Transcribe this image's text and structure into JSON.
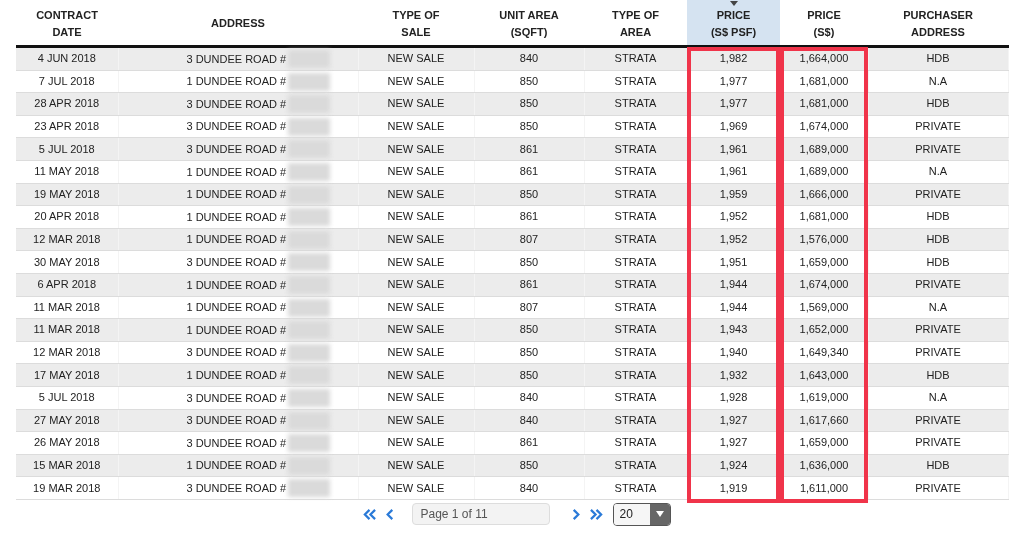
{
  "table": {
    "address_redacted": true,
    "columns": [
      {
        "label": "CONTRACT\nDATE",
        "sorted": false,
        "highlighted": false
      },
      {
        "label": "ADDRESS",
        "sorted": false,
        "highlighted": false
      },
      {
        "label": "TYPE OF\nSALE",
        "sorted": false,
        "highlighted": false
      },
      {
        "label": "UNIT AREA\n(SQFT)",
        "sorted": false,
        "highlighted": false
      },
      {
        "label": "TYPE OF\nAREA",
        "sorted": false,
        "highlighted": false
      },
      {
        "label": "PRICE\n(S$ PSF)",
        "sorted": true,
        "highlighted": true
      },
      {
        "label": "PRICE\n(S$)",
        "sorted": false,
        "highlighted": true
      },
      {
        "label": "PURCHASER\nADDRESS",
        "sorted": false,
        "highlighted": false
      }
    ],
    "rows": [
      [
        "4 JUN 2018",
        "3 DUNDEE ROAD #",
        "NEW SALE",
        "840",
        "STRATA",
        "1,982",
        "1,664,000",
        "HDB"
      ],
      [
        "7 JUL 2018",
        "1 DUNDEE ROAD #",
        "NEW SALE",
        "850",
        "STRATA",
        "1,977",
        "1,681,000",
        "N.A"
      ],
      [
        "28 APR 2018",
        "3 DUNDEE ROAD #",
        "NEW SALE",
        "850",
        "STRATA",
        "1,977",
        "1,681,000",
        "HDB"
      ],
      [
        "23 APR 2018",
        "3 DUNDEE ROAD #",
        "NEW SALE",
        "850",
        "STRATA",
        "1,969",
        "1,674,000",
        "PRIVATE"
      ],
      [
        "5 JUL 2018",
        "3 DUNDEE ROAD #",
        "NEW SALE",
        "861",
        "STRATA",
        "1,961",
        "1,689,000",
        "PRIVATE"
      ],
      [
        "11 MAY 2018",
        "1 DUNDEE ROAD #",
        "NEW SALE",
        "861",
        "STRATA",
        "1,961",
        "1,689,000",
        "N.A"
      ],
      [
        "19 MAY 2018",
        "1 DUNDEE ROAD #",
        "NEW SALE",
        "850",
        "STRATA",
        "1,959",
        "1,666,000",
        "PRIVATE"
      ],
      [
        "20 APR 2018",
        "1 DUNDEE ROAD #",
        "NEW SALE",
        "861",
        "STRATA",
        "1,952",
        "1,681,000",
        "HDB"
      ],
      [
        "12 MAR 2018",
        "1 DUNDEE ROAD #",
        "NEW SALE",
        "807",
        "STRATA",
        "1,952",
        "1,576,000",
        "HDB"
      ],
      [
        "30 MAY 2018",
        "3 DUNDEE ROAD #",
        "NEW SALE",
        "850",
        "STRATA",
        "1,951",
        "1,659,000",
        "HDB"
      ],
      [
        "6 APR 2018",
        "1 DUNDEE ROAD #",
        "NEW SALE",
        "861",
        "STRATA",
        "1,944",
        "1,674,000",
        "PRIVATE"
      ],
      [
        "11 MAR 2018",
        "1 DUNDEE ROAD #",
        "NEW SALE",
        "807",
        "STRATA",
        "1,944",
        "1,569,000",
        "N.A"
      ],
      [
        "11 MAR 2018",
        "1 DUNDEE ROAD #",
        "NEW SALE",
        "850",
        "STRATA",
        "1,943",
        "1,652,000",
        "PRIVATE"
      ],
      [
        "12 MAR 2018",
        "3 DUNDEE ROAD #",
        "NEW SALE",
        "850",
        "STRATA",
        "1,940",
        "1,649,340",
        "PRIVATE"
      ],
      [
        "17 MAY 2018",
        "1 DUNDEE ROAD #",
        "NEW SALE",
        "850",
        "STRATA",
        "1,932",
        "1,643,000",
        "HDB"
      ],
      [
        "5 JUL 2018",
        "3 DUNDEE ROAD #",
        "NEW SALE",
        "840",
        "STRATA",
        "1,928",
        "1,619,000",
        "N.A"
      ],
      [
        "27 MAY 2018",
        "3 DUNDEE ROAD #",
        "NEW SALE",
        "840",
        "STRATA",
        "1,927",
        "1,617,660",
        "PRIVATE"
      ],
      [
        "26 MAY 2018",
        "3 DUNDEE ROAD #",
        "NEW SALE",
        "861",
        "STRATA",
        "1,927",
        "1,659,000",
        "PRIVATE"
      ],
      [
        "15 MAR 2018",
        "1 DUNDEE ROAD #",
        "NEW SALE",
        "850",
        "STRATA",
        "1,924",
        "1,636,000",
        "HDB"
      ],
      [
        "19 MAR 2018",
        "3 DUNDEE ROAD #",
        "NEW SALE",
        "840",
        "STRATA",
        "1,919",
        "1,611,000",
        "PRIVATE"
      ]
    ]
  },
  "pagination": {
    "page_field": {
      "placeholder": "Page 1 of 11"
    },
    "page_size": "20"
  }
}
